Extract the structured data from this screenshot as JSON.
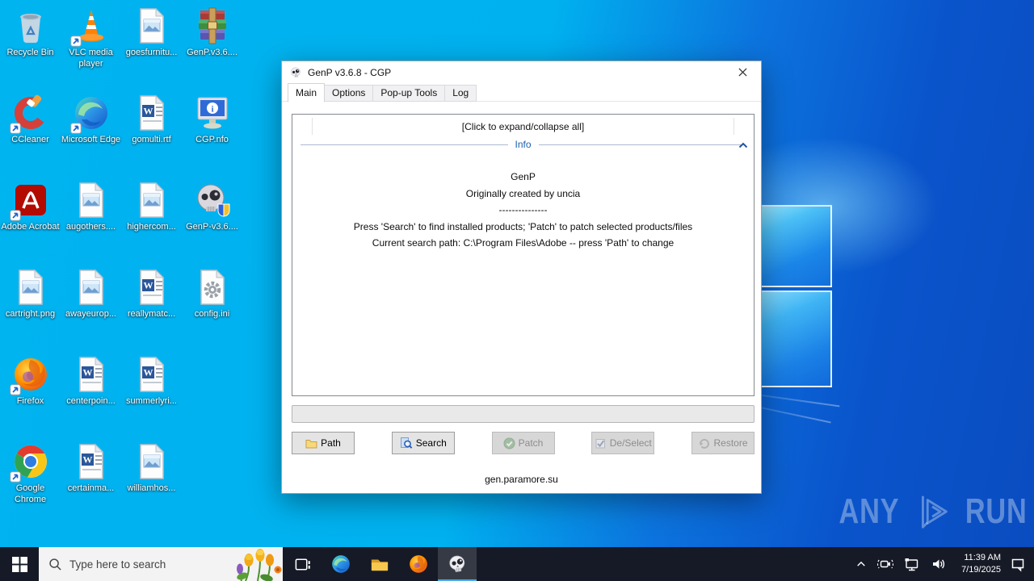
{
  "desktop": {
    "icons": [
      {
        "label": "Recycle Bin"
      },
      {
        "label": "VLC media player"
      },
      {
        "label": "goesfurnitu..."
      },
      {
        "label": "GenP.v3.6...."
      },
      {
        "label": "CCleaner"
      },
      {
        "label": "Microsoft Edge"
      },
      {
        "label": "gomulti.rtf"
      },
      {
        "label": "CGP.nfo"
      },
      {
        "label": "Adobe Acrobat"
      },
      {
        "label": "augothers...."
      },
      {
        "label": "highercom..."
      },
      {
        "label": "GenP-v3.6...."
      },
      {
        "label": "cartright.png"
      },
      {
        "label": "awayeurop..."
      },
      {
        "label": "reallymatc..."
      },
      {
        "label": "config.ini"
      },
      {
        "label": "Firefox"
      },
      {
        "label": "centerpoin..."
      },
      {
        "label": "summerlyri..."
      },
      {
        "label": "Google Chrome"
      },
      {
        "label": "certainma..."
      },
      {
        "label": "williamhos..."
      }
    ]
  },
  "window": {
    "title": "GenP v3.6.8 - CGP",
    "tabs": [
      "Main",
      "Options",
      "Pop-up Tools",
      "Log"
    ],
    "expand_header": "[Click to expand/collapse all]",
    "section_label": "Info",
    "info_lines": [
      "GenP",
      "Originally created by uncia",
      "---------------",
      "Press 'Search' to find installed products; 'Patch' to patch selected products/files",
      "Current search path: C:\\Program Files\\Adobe -- press 'Path' to change"
    ],
    "buttons": [
      {
        "label": "Path",
        "enabled": true
      },
      {
        "label": "Search",
        "enabled": true
      },
      {
        "label": "Patch",
        "enabled": false
      },
      {
        "label": "De/Select",
        "enabled": false
      },
      {
        "label": "Restore",
        "enabled": false
      }
    ],
    "footer": "gen.paramore.su"
  },
  "taskbar": {
    "search_placeholder": "Type here to search",
    "clock": {
      "time": "11:39 AM",
      "date": "7/19/2025"
    }
  },
  "watermark": {
    "any": "ANY",
    "run": "RUN"
  },
  "colors": {
    "wallpaper_cyan": "#00b1ee",
    "wallpaper_blue": "#0a50c6",
    "taskbar_bg": "#161a26",
    "active_app_underline": "#48a8e8",
    "info_link_blue": "#1f5fae"
  }
}
